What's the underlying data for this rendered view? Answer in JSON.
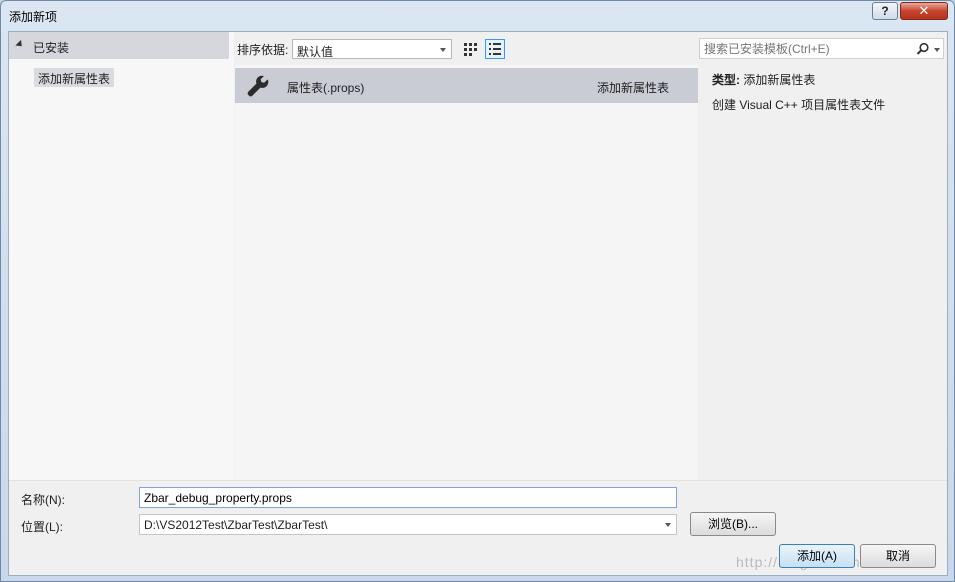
{
  "window": {
    "title": "添加新项",
    "help_label": "?",
    "close_label": "✕"
  },
  "left_pane": {
    "header": "已安装",
    "items": [
      {
        "label": "添加新属性表",
        "selected": true
      }
    ]
  },
  "sortbar": {
    "label": "排序依据:",
    "selected": "默认值"
  },
  "templates": [
    {
      "name": "属性表(.props)",
      "category": "添加新属性表",
      "icon": "wrench-icon"
    }
  ],
  "search": {
    "placeholder": "搜索已安装模板(Ctrl+E)"
  },
  "details": {
    "type_key": "类型:",
    "type_value": "添加新属性表",
    "description": "创建 Visual C++ 项目属性表文件"
  },
  "form": {
    "name_label": "名称(N):",
    "name_value": "Zbar_debug_property.props",
    "location_label": "位置(L):",
    "location_value": "D:\\VS2012Test\\ZbarTest\\ZbarTest\\",
    "browse_label": "浏览(B)...",
    "add_label": "添加(A)",
    "cancel_label": "取消"
  },
  "watermark": "http://blog.csdn.net/",
  "colors": {
    "accent": "#3399ff",
    "selection": "#c9ccd4",
    "close_red": "#c7432e"
  }
}
